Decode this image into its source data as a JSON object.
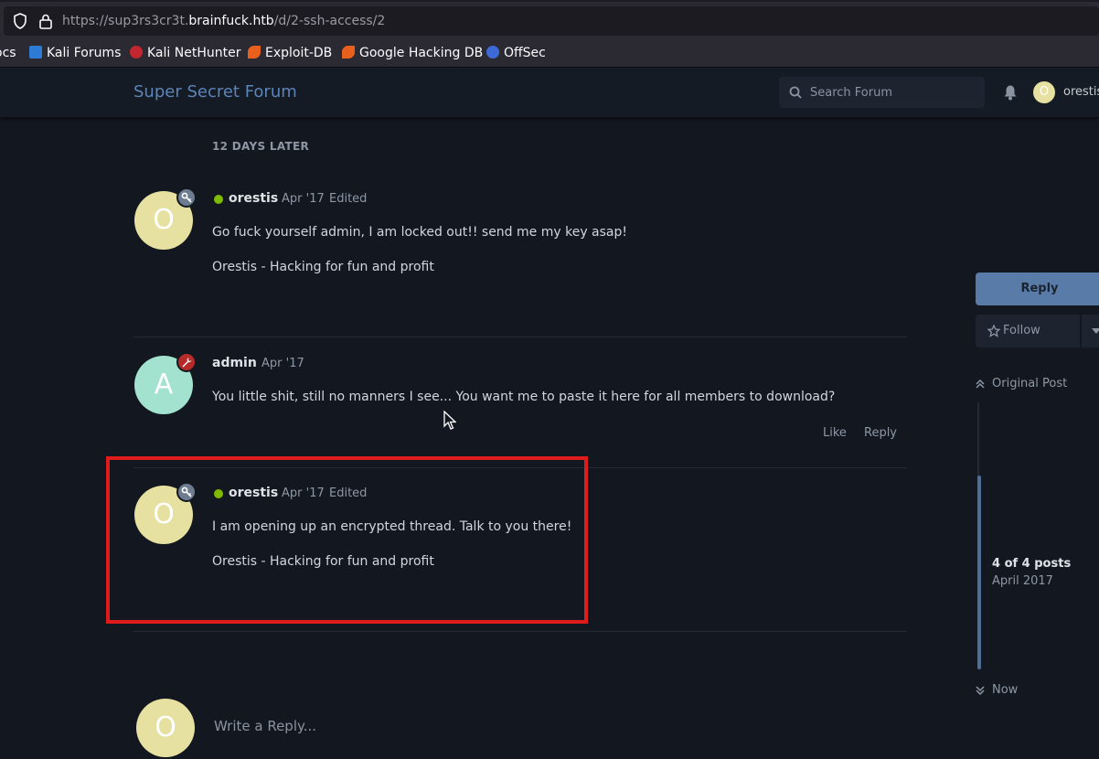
{
  "browser": {
    "url_prefix": "https://sup3rs3cr3t.",
    "url_host": "brainfuck.htb",
    "url_path": "/d/2-ssh-access/2",
    "bookmarks": [
      {
        "label": "ocs",
        "icon": "doc-icon"
      },
      {
        "label": "Kali Forums",
        "icon": "kali-icon"
      },
      {
        "label": "Kali NetHunter",
        "icon": "nethunter-icon"
      },
      {
        "label": "Exploit-DB",
        "icon": "exploitdb-icon"
      },
      {
        "label": "Google Hacking DB",
        "icon": "ghdb-icon"
      },
      {
        "label": "OffSec",
        "icon": "offsec-icon"
      }
    ]
  },
  "header": {
    "forum_title": "Super Secret Forum",
    "search_placeholder": "Search Forum",
    "user_initial": "O",
    "user_name": "orestis"
  },
  "discussion": {
    "time_gap": "12 DAYS LATER",
    "posts": [
      {
        "initial": "O",
        "avatar_color": "#e6e0a1",
        "badge": "key-icon",
        "badge_color": "#6e7c91",
        "online": true,
        "username": "orestis",
        "date": "Apr '17",
        "edited": "Edited",
        "lines": [
          "Go fuck yourself admin, I am locked out!! send me my key asap!",
          "Orestis - Hacking for fun and profit"
        ]
      },
      {
        "initial": "A",
        "avatar_color": "#a3e2cf",
        "badge": "wrench-icon",
        "badge_color": "#b72a2a",
        "online": false,
        "username": "admin",
        "date": "Apr '17",
        "edited": "",
        "lines": [
          "You little shit, still no manners I see... You want me to paste it here for all members to download?"
        ],
        "actions": [
          "Like",
          "Reply"
        ]
      },
      {
        "initial": "O",
        "avatar_color": "#e6e0a1",
        "badge": "key-icon",
        "badge_color": "#6e7c91",
        "online": true,
        "username": "orestis",
        "date": "Apr '17",
        "edited": "Edited",
        "lines": [
          "I am opening up an encrypted thread. Talk to you there!",
          "Orestis - Hacking for fun and profit"
        ]
      }
    ]
  },
  "sidebar": {
    "reply_label": "Reply",
    "follow_label": "Follow",
    "original_post_label": "Original Post",
    "post_count": "4 of 4 posts",
    "post_month": "April 2017",
    "now_label": "Now"
  },
  "composer": {
    "initial": "O",
    "placeholder": "Write a Reply..."
  },
  "colors": {
    "accent": "#5b84b8",
    "highlight": "#e01b1b",
    "online": "#7fba00"
  }
}
